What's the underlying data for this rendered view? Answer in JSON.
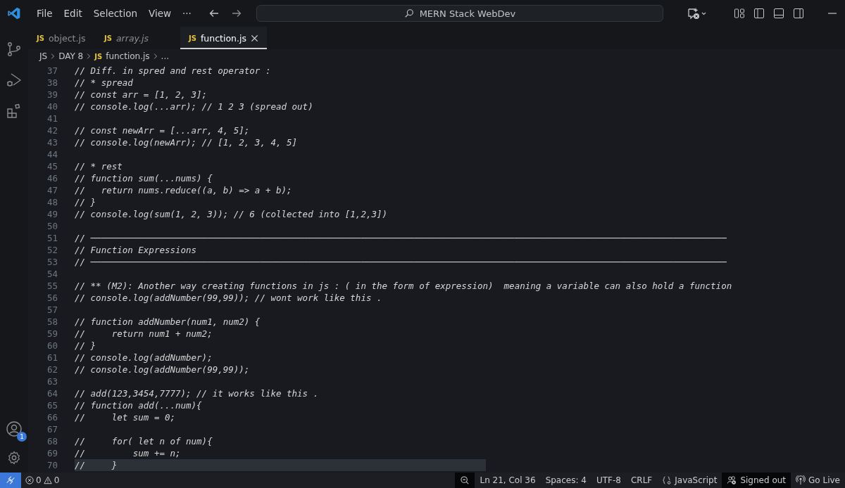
{
  "menu": [
    "File",
    "Edit",
    "Selection",
    "View",
    "···"
  ],
  "search": {
    "value": "MERN Stack WebDev"
  },
  "tabs": [
    {
      "badge": "JS",
      "label": "object.js",
      "selected": false,
      "preview": false
    },
    {
      "badge": "JS",
      "label": "array.js",
      "selected": false,
      "preview": true
    },
    {
      "badge": "JS",
      "label": "function.js",
      "selected": true,
      "preview": false
    }
  ],
  "breadcrumb": [
    {
      "label": "JS"
    },
    {
      "label": "DAY 8"
    },
    {
      "badge": "JS",
      "label": "function.js"
    },
    {
      "label": "..."
    }
  ],
  "editor": {
    "lines": [
      {
        "number": "37",
        "text": "// Diff. in spred and rest operator :",
        "current": false
      },
      {
        "number": "38",
        "text": "// * spread",
        "current": false
      },
      {
        "number": "39",
        "text": "// const arr = [1, 2, 3];",
        "current": false
      },
      {
        "number": "40",
        "text": "// console.log(...arr); // 1 2 3 (spread out)",
        "current": false
      },
      {
        "number": "41",
        "current": false
      },
      {
        "number": "42",
        "text": "// const newArr = [...arr, 4, 5];",
        "current": false
      },
      {
        "number": "43",
        "text": "// console.log(newArr); // [1, 2, 3, 4, 5]",
        "current": false
      },
      {
        "number": "44",
        "current": false
      },
      {
        "number": "45",
        "text": "// * rest",
        "current": false
      },
      {
        "number": "46",
        "text": "// function sum(...nums) {",
        "current": false
      },
      {
        "number": "47",
        "text": "//   return nums.reduce((a, b) => a + b);",
        "current": false
      },
      {
        "number": "48",
        "text": "// }",
        "current": false
      },
      {
        "number": "49",
        "text": "// console.log(sum(1, 2, 3)); // 6 (collected into [1,2,3])",
        "current": false
      },
      {
        "number": "50",
        "current": false
      },
      {
        "number": "51",
        "text": "// ────────────────────────────────────────────────────────────────────────────────────────────────────────────────────────",
        "current": false
      },
      {
        "number": "52",
        "text": "// Function Expressions",
        "current": false
      },
      {
        "number": "53",
        "text": "// ────────────────────────────────────────────────────────────────────────────────────────────────────────────────────────",
        "current": false
      },
      {
        "number": "54",
        "current": false
      },
      {
        "number": "55",
        "text": "// ** (M2): Another way creating functions in js : ( in the form of expression)  meaning a variable can also hold a function",
        "current": false
      },
      {
        "number": "56",
        "text": "// console.log(addNumber(99,99)); // wont work like this .",
        "current": false
      },
      {
        "number": "57",
        "current": false
      },
      {
        "number": "58",
        "text": "// function addNumber(num1, num2) {",
        "current": false
      },
      {
        "number": "59",
        "text": "//     return num1 + num2;",
        "current": false
      },
      {
        "number": "60",
        "text": "// }",
        "current": false
      },
      {
        "number": "61",
        "text": "// console.log(addNumber);",
        "current": false
      },
      {
        "number": "62",
        "text": "// console.log(addNumber(99,99));",
        "current": false
      },
      {
        "number": "63",
        "current": false
      },
      {
        "number": "64",
        "text": "// add(123,3454,7777); // it works like this .",
        "current": false
      },
      {
        "number": "65",
        "text": "// function add(...num){",
        "current": false
      },
      {
        "number": "66",
        "text": "//     let sum = 0;",
        "current": false
      },
      {
        "number": "67",
        "current": false
      },
      {
        "number": "68",
        "text": "//     for( let n of num){",
        "current": false
      },
      {
        "number": "69",
        "text": "//         sum += n;",
        "current": false
      },
      {
        "number": "70",
        "text": "//     }",
        "current": true
      }
    ]
  },
  "activity": {
    "account_badge": "1"
  },
  "status_bar": {
    "errors": "0",
    "warnings": "0",
    "items": [
      {
        "kind": "zoom",
        "highlighted": true
      },
      {
        "kind": "text",
        "label": "Ln 21, Col 36",
        "highlighted": false
      },
      {
        "kind": "text",
        "label": "Spaces: 4",
        "highlighted": false
      },
      {
        "kind": "text",
        "label": "UTF-8",
        "highlighted": false
      },
      {
        "kind": "text",
        "label": "CRLF",
        "highlighted": false
      },
      {
        "kind": "language",
        "label": "JavaScript",
        "highlighted": false
      },
      {
        "kind": "account",
        "label": "Signed out",
        "highlighted": true
      },
      {
        "kind": "live",
        "label": "Go Live",
        "highlighted": false
      }
    ]
  }
}
